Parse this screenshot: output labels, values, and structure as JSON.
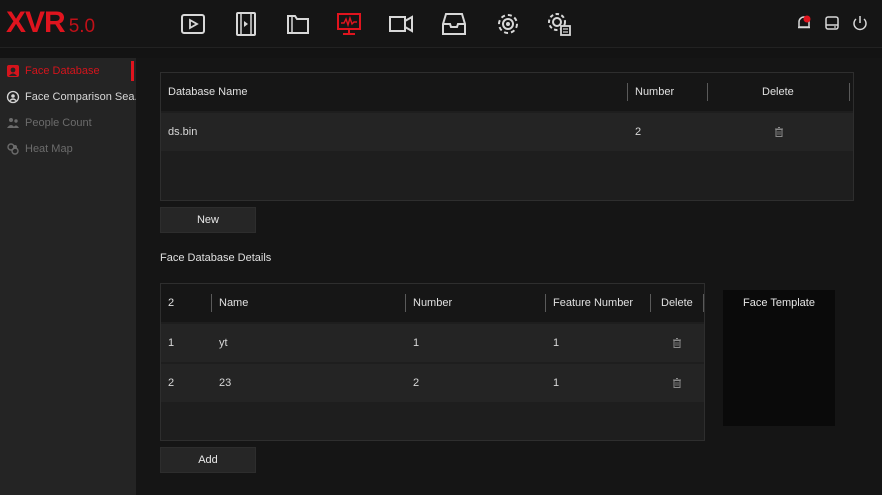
{
  "logo": {
    "brand": "XVR",
    "version": "5.0"
  },
  "topnav": [
    {
      "name": "playback-icon"
    },
    {
      "name": "video-clip-icon"
    },
    {
      "name": "file-folder-icon"
    },
    {
      "name": "system-monitor-icon"
    },
    {
      "name": "camera-icon"
    },
    {
      "name": "backup-tray-icon"
    },
    {
      "name": "settings-gear-icon"
    },
    {
      "name": "advanced-settings-icon"
    }
  ],
  "status_icons": [
    {
      "name": "alarm-bell-icon"
    },
    {
      "name": "hdd-icon"
    },
    {
      "name": "power-icon"
    }
  ],
  "colors": {
    "accent": "#e0141e",
    "background": "#131313",
    "sidebar": "#242424"
  },
  "sidebar": {
    "items": [
      {
        "label": "Face Database",
        "icon": "face-database-icon",
        "state": "active"
      },
      {
        "label": "Face Comparison Sea...",
        "icon": "face-search-icon",
        "state": "normal"
      },
      {
        "label": "People Count",
        "icon": "people-count-icon",
        "state": "disabled"
      },
      {
        "label": "Heat Map",
        "icon": "heat-map-icon",
        "state": "disabled"
      }
    ]
  },
  "database_table": {
    "columns": {
      "name": "Database Name",
      "number": "Number",
      "delete": "Delete"
    },
    "rows": [
      {
        "name": "ds.bin",
        "number": "2"
      }
    ]
  },
  "buttons": {
    "new": "New",
    "add": "Add"
  },
  "details": {
    "title": "Face Database Details",
    "columns": {
      "count": "2",
      "name": "Name",
      "number": "Number",
      "feature": "Feature Number",
      "delete": "Delete"
    },
    "rows": [
      {
        "index": "1",
        "name": "yt",
        "number": "1",
        "feature": "1"
      },
      {
        "index": "2",
        "name": "23",
        "number": "2",
        "feature": "1"
      }
    ]
  },
  "face_template": {
    "label": "Face Template"
  }
}
